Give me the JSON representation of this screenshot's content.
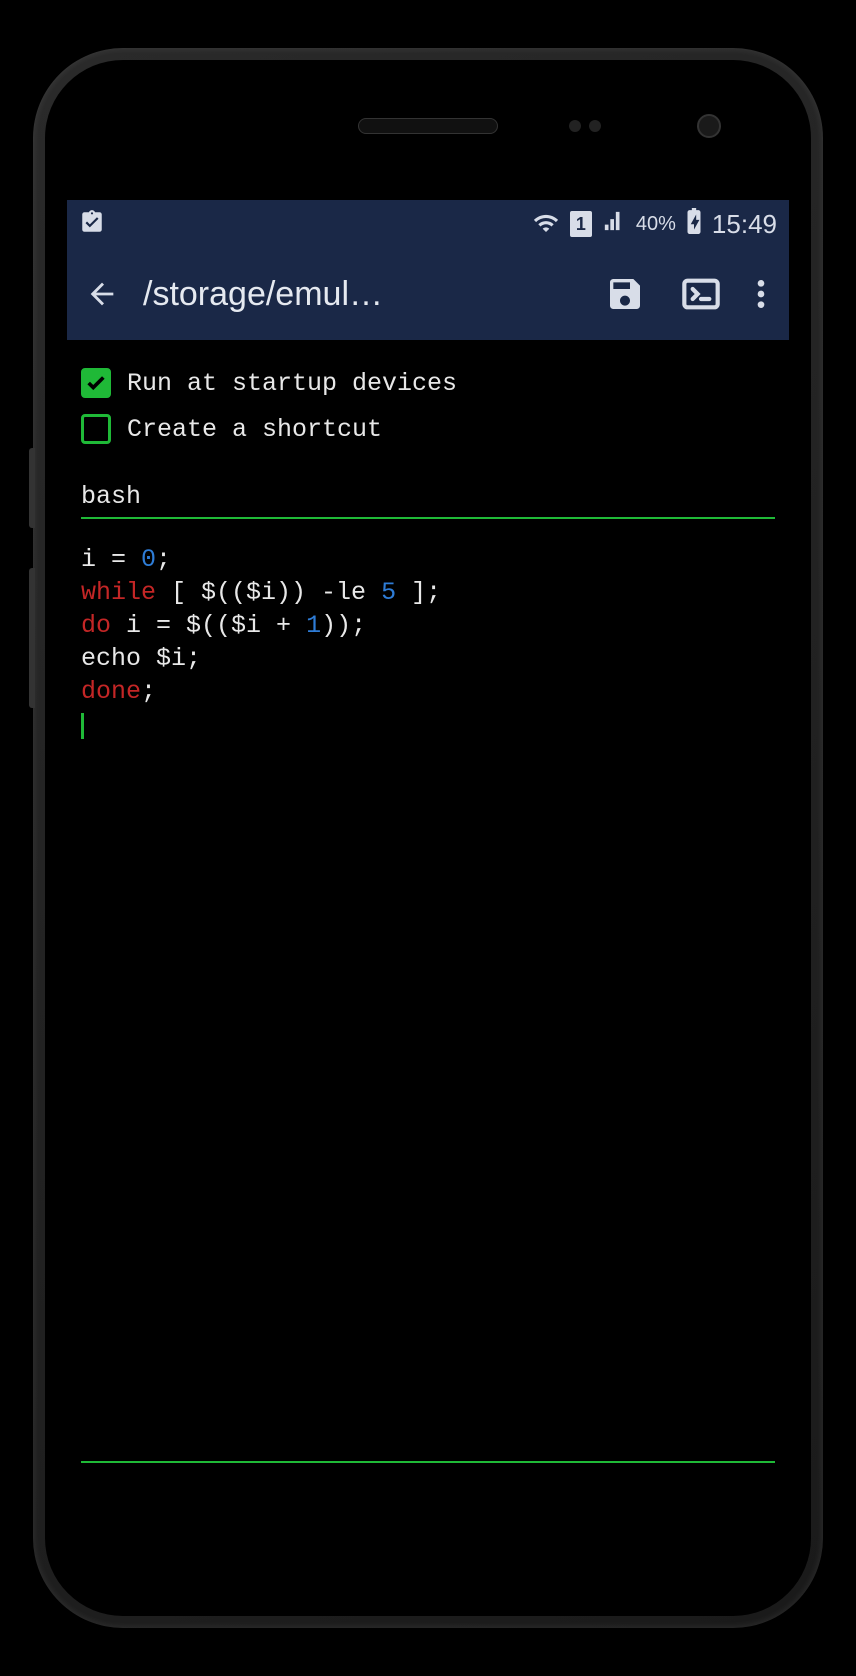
{
  "status_bar": {
    "battery_percent": "40%",
    "clock": "15:49",
    "sim_indicator": "1"
  },
  "app_bar": {
    "title": "/storage/emul…"
  },
  "options": {
    "run_at_startup": {
      "label": "Run at startup devices",
      "checked": true
    },
    "create_shortcut": {
      "label": "Create a shortcut",
      "checked": false
    }
  },
  "script_name_input": "bash",
  "code": {
    "lines": [
      {
        "segments": [
          {
            "t": "i = "
          },
          {
            "t": "0",
            "c": "num-blue"
          },
          {
            "t": ";"
          }
        ]
      },
      {
        "segments": [
          {
            "t": "while",
            "c": "kw-red"
          },
          {
            "t": " [ $(($i)) -le "
          },
          {
            "t": "5",
            "c": "num-blue"
          },
          {
            "t": " ];"
          }
        ]
      },
      {
        "segments": [
          {
            "t": "do",
            "c": "kw-red"
          },
          {
            "t": " i = $(($i + "
          },
          {
            "t": "1",
            "c": "num-blue"
          },
          {
            "t": "));"
          }
        ]
      },
      {
        "segments": [
          {
            "t": "echo $i;"
          }
        ]
      },
      {
        "segments": [
          {
            "t": "done",
            "c": "kw-red"
          },
          {
            "t": ";"
          }
        ]
      }
    ]
  }
}
